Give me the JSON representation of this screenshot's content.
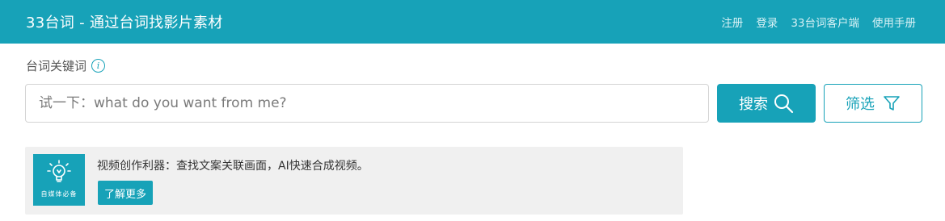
{
  "header": {
    "brand": "33台词 - 通过台词找影片素材",
    "nav": [
      {
        "label": "注册"
      },
      {
        "label": "登录"
      },
      {
        "label": "33台词客户端"
      },
      {
        "label": "使用手册"
      }
    ]
  },
  "search": {
    "label": "台词关键词",
    "info_icon": "info-icon",
    "placeholder": "试一下：what do you want from me?",
    "value": "",
    "search_button": "搜索",
    "search_icon": "search-icon",
    "filter_button": "筛选",
    "filter_icon": "filter-funnel-icon"
  },
  "promo": {
    "logo_icon": "lightbulb-icon",
    "logo_text": "自媒体必备",
    "text": "视频创作利器：查找文案关联画面，AI快速合成视频。",
    "button": "了解更多"
  },
  "colors": {
    "accent": "#17a2b8",
    "promo_bg": "#f0f0f0"
  }
}
